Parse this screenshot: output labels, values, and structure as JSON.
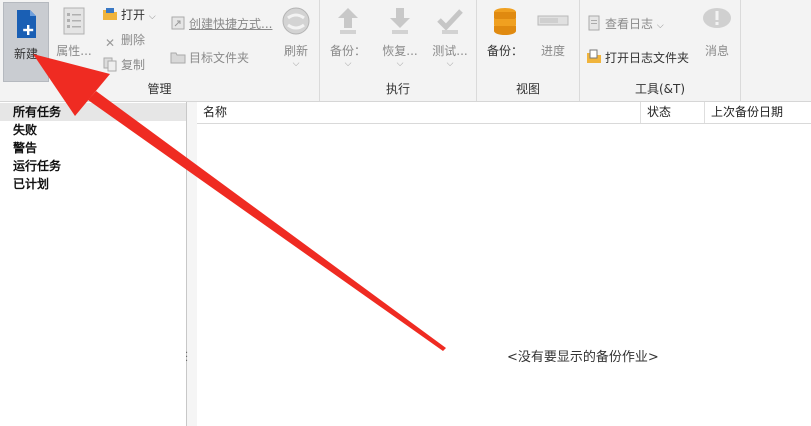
{
  "ribbon": {
    "manage": {
      "label": "管理",
      "new_label": "新建",
      "properties_label": "属性...",
      "open_label": "打开",
      "delete_label": "删除",
      "copy_label": "复制",
      "shortcut_label": "创建快捷方式...",
      "target_folder_label": "目标文件夹",
      "refresh_label": "刷新"
    },
    "execute": {
      "label": "执行",
      "backup_label": "备份：",
      "restore_label": "恢复...",
      "test_label": "测试..."
    },
    "view": {
      "label": "视图",
      "backup_label": "备份：",
      "progress_label": "进度"
    },
    "tools": {
      "label": "工具(&T)",
      "view_log_label": "查看日志",
      "open_log_folder_label": "打开日志文件夹",
      "messages_label": "消息"
    }
  },
  "tree": {
    "items": [
      {
        "label": "所有任务"
      },
      {
        "label": "失败"
      },
      {
        "label": "警告"
      },
      {
        "label": "运行任务"
      },
      {
        "label": "已计划"
      }
    ]
  },
  "list": {
    "columns": [
      {
        "label": "名称"
      },
      {
        "label": "状态"
      },
      {
        "label": "上次备份日期"
      }
    ],
    "empty_message": "<没有要显示的备份作业>"
  },
  "colors": {
    "accent_blue": "#1a5fb4",
    "arrow_red": "#ef2b22",
    "backup_orange": "#f0a020"
  }
}
